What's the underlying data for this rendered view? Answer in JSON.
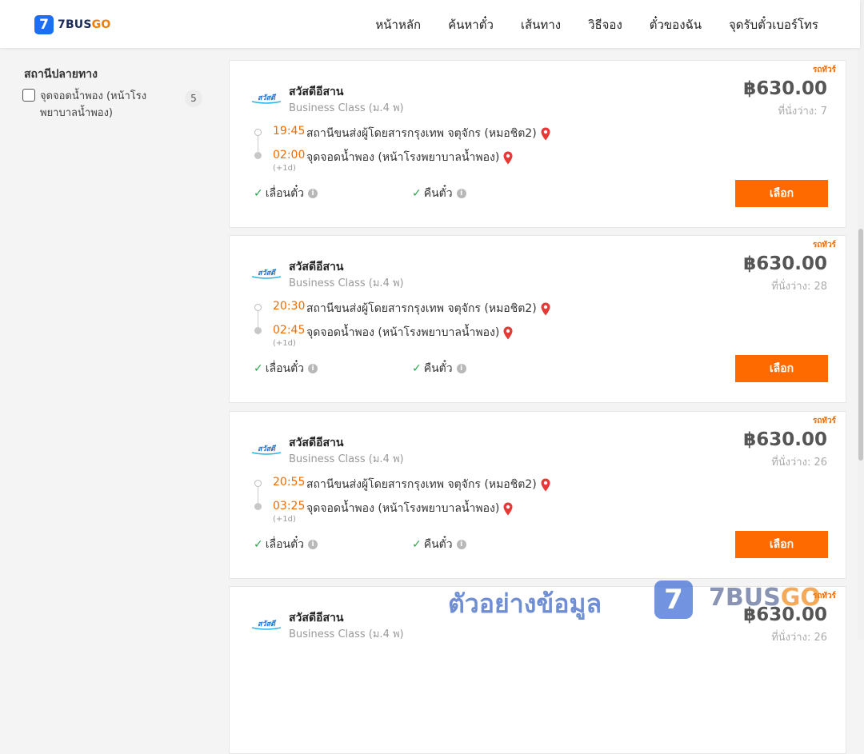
{
  "header": {
    "logo_mark": "7",
    "logo_name": "7BUS",
    "logo_go": "GO",
    "nav": [
      "หน้าหลัก",
      "ค้นหาตั๋ว",
      "เส้นทาง",
      "วิธีจอง",
      "ตั๋วของฉัน",
      "จุดรับตั๋วเบอร์โทร"
    ]
  },
  "sidebar": {
    "filter_title": "สถานีปลายทาง",
    "filter_option": {
      "label": "จุดจอดน้ำพอง (หน้าโรงพยาบาลน้ำพอง)",
      "count": "5",
      "checked": false
    }
  },
  "trips": [
    {
      "tag": "รถทัวร์",
      "operator": "สวัสดีอีสาน",
      "class": "Business Class (ม.4 พ)",
      "price": "฿630.00",
      "seats": "ที่นั่งว่าง: 7",
      "dep_time": "19:45",
      "dep_stop": "สถานีขนส่งผู้โดยสารกรุงเทพ จตุจักร (หมอชิต2)",
      "arr_time": "02:00",
      "arr_stop": "จุดจอดน้ำพอง (หน้าโรงพยาบาลน้ำพอง)",
      "plus_day": "(+1d)",
      "feature_1": "เลื่อนตั๋ว",
      "feature_2": "คืนตั๋ว",
      "button": "เลือก"
    },
    {
      "tag": "รถทัวร์",
      "operator": "สวัสดีอีสาน",
      "class": "Business Class (ม.4 พ)",
      "price": "฿630.00",
      "seats": "ที่นั่งว่าง: 28",
      "dep_time": "20:30",
      "dep_stop": "สถานีขนส่งผู้โดยสารกรุงเทพ จตุจักร (หมอชิต2)",
      "arr_time": "02:45",
      "arr_stop": "จุดจอดน้ำพอง (หน้าโรงพยาบาลน้ำพอง)",
      "plus_day": "(+1d)",
      "feature_1": "เลื่อนตั๋ว",
      "feature_2": "คืนตั๋ว",
      "button": "เลือก"
    },
    {
      "tag": "รถทัวร์",
      "operator": "สวัสดีอีสาน",
      "class": "Business Class (ม.4 พ)",
      "price": "฿630.00",
      "seats": "ที่นั่งว่าง: 26",
      "dep_time": "20:55",
      "dep_stop": "สถานีขนส่งผู้โดยสารกรุงเทพ จตุจักร (หมอชิต2)",
      "arr_time": "03:25",
      "arr_stop": "จุดจอดน้ำพอง (หน้าโรงพยาบาลน้ำพอง)",
      "plus_day": "(+1d)",
      "feature_1": "เลื่อนตั๋ว",
      "feature_2": "คืนตั๋ว",
      "button": "เลือก"
    },
    {
      "tag": "รถทัวร์",
      "operator": "สวัสดีอีสาน",
      "class": "Business Class (ม.4 พ)",
      "price": "฿630.00",
      "seats": "ที่นั่งว่าง: 26",
      "dep_time": "",
      "dep_stop": "",
      "arr_time": "",
      "arr_stop": "",
      "plus_day": "",
      "feature_1": "",
      "feature_2": "",
      "button": ""
    }
  ],
  "watermark": {
    "text": "ตัวอย่างข้อมูล",
    "badge": "7",
    "brand": "7BUS",
    "brand_go": "GO"
  },
  "colors": {
    "accent_orange": "#ff6a00",
    "time_orange": "#f26b00",
    "brand_blue": "#1d6ef0",
    "check_green": "#2ea44f",
    "pin_red": "#e53935"
  }
}
